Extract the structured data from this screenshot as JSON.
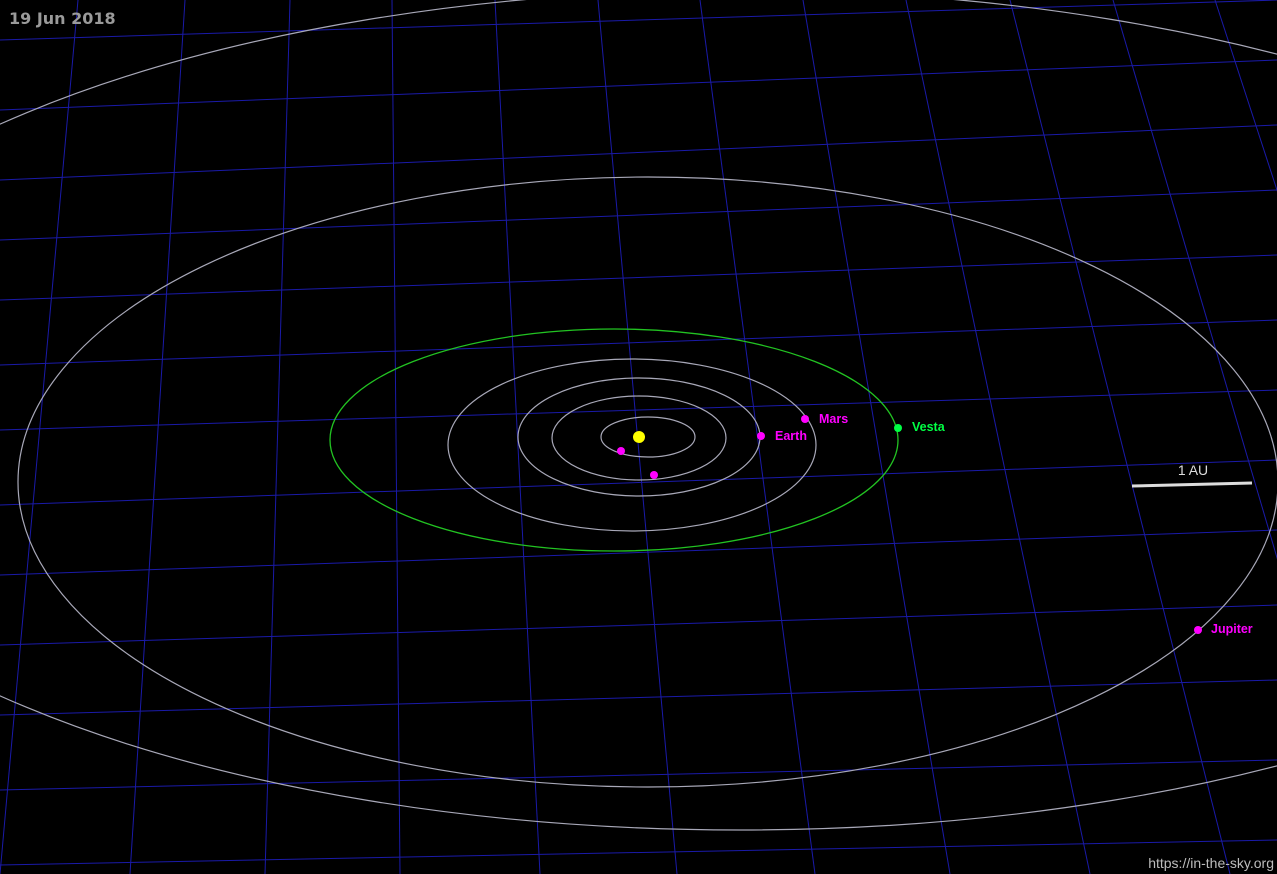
{
  "date": "19 Jun 2018",
  "credit": "https://in-the-sky.org",
  "scale_bar_label": "1 AU",
  "colors": {
    "background": "#000000",
    "grid": "#1a1aa8",
    "planet_orbit": "#a8a8b8",
    "asteroid_orbit": "#22c322",
    "sun": "#ffff00",
    "planet_marker": "#ff00ff",
    "asteroid_marker": "#00ff44",
    "scale_bar": "#dddddd"
  },
  "sun": {
    "name": "sun-marker"
  },
  "bodies": [
    {
      "id": "mercury",
      "label": "",
      "kind": "planet",
      "labeled": false
    },
    {
      "id": "venus",
      "label": "",
      "kind": "planet",
      "labeled": false
    },
    {
      "id": "earth",
      "label": "Earth",
      "kind": "planet",
      "labeled": true
    },
    {
      "id": "mars",
      "label": "Mars",
      "kind": "planet",
      "labeled": true
    },
    {
      "id": "vesta",
      "label": "Vesta",
      "kind": "asteroid",
      "labeled": true
    },
    {
      "id": "jupiter",
      "label": "Jupiter",
      "kind": "planet",
      "labeled": true
    }
  ]
}
